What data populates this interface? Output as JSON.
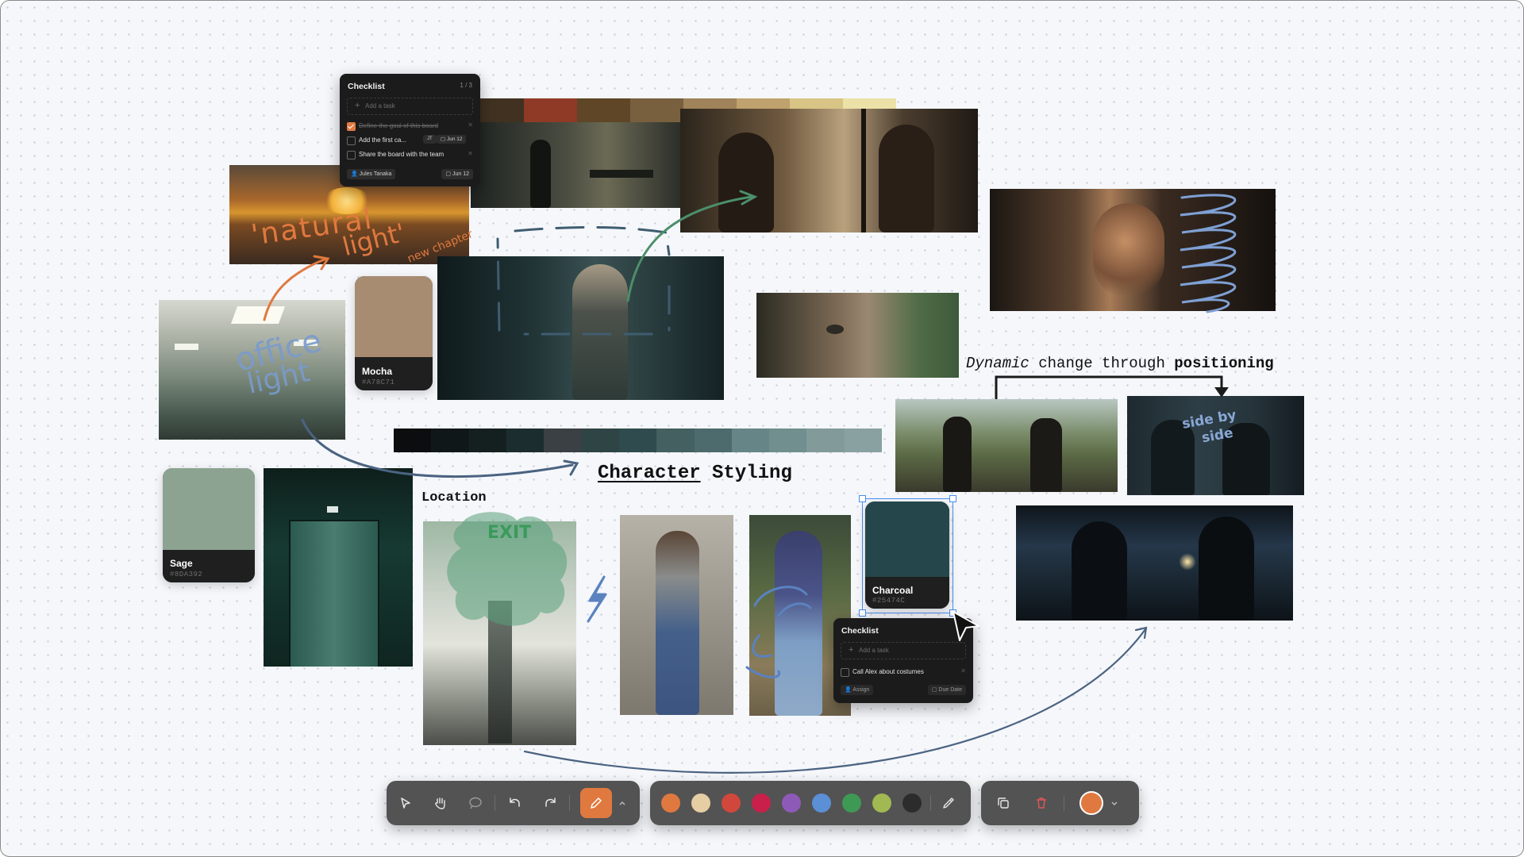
{
  "board": {
    "heading_character": "Character",
    "heading_styling": "Styling",
    "heading_location": "Location",
    "caption_dynamic": "Dynamic",
    "caption_change": "change through",
    "caption_positioning": "positioning"
  },
  "swatches": [
    {
      "name": "Mocha",
      "hex": "#A78C71"
    },
    {
      "name": "Sage",
      "hex": "#8DA392"
    },
    {
      "name": "Charcoal",
      "hex": "#25474C"
    }
  ],
  "palette_warm": [
    "#403121",
    "#8e3a26",
    "#5e4627",
    "#78603f",
    "#a0835a",
    "#bfa26d",
    "#d8c586",
    "#ece2a8"
  ],
  "palette_teal": [
    "#0b0d0e",
    "#101718",
    "#14201f",
    "#1c2d2f",
    "#3b4044",
    "#2f4444",
    "#2f4b4d",
    "#446061",
    "#4d6a6c",
    "#668586",
    "#708f8e",
    "#829a9a",
    "#8aa1a2"
  ],
  "annotations": {
    "natural": "'natural",
    "light": "light'",
    "new_chapter": "new chapter",
    "office": "office",
    "office_light": "light",
    "side_by": "side by",
    "side": "side",
    "exit_sign": "EXIT"
  },
  "checklist_main": {
    "title": "Checklist",
    "count": "1 / 3",
    "add_placeholder": "Add a task",
    "items": [
      {
        "label": "Define the goal of this board",
        "done": true
      },
      {
        "label": "Add the first ca...",
        "done": false,
        "assignee": "JT",
        "due": "Jun 12"
      },
      {
        "label": "Share the board with the team",
        "done": false
      }
    ],
    "footer_assignee": "Jules Tanaka",
    "footer_due": "Jun 12"
  },
  "checklist_small": {
    "title": "Checklist",
    "add_placeholder": "Add a task",
    "items": [
      {
        "label": "Call Alex about costumes",
        "done": false
      }
    ],
    "footer_assign": "Assign",
    "footer_due": "Due Date"
  },
  "toolbar": {
    "tools": [
      "select-tool",
      "hand-tool",
      "lasso-tool",
      "undo",
      "redo",
      "pen-tool"
    ],
    "colors": [
      "#e0793f",
      "#e6cda4",
      "#d2473b",
      "#c8204a",
      "#8e5ab8",
      "#5b8fd6",
      "#3e9955",
      "#a2b852",
      "#2c2c2c"
    ],
    "active_color": "#e0793f"
  }
}
